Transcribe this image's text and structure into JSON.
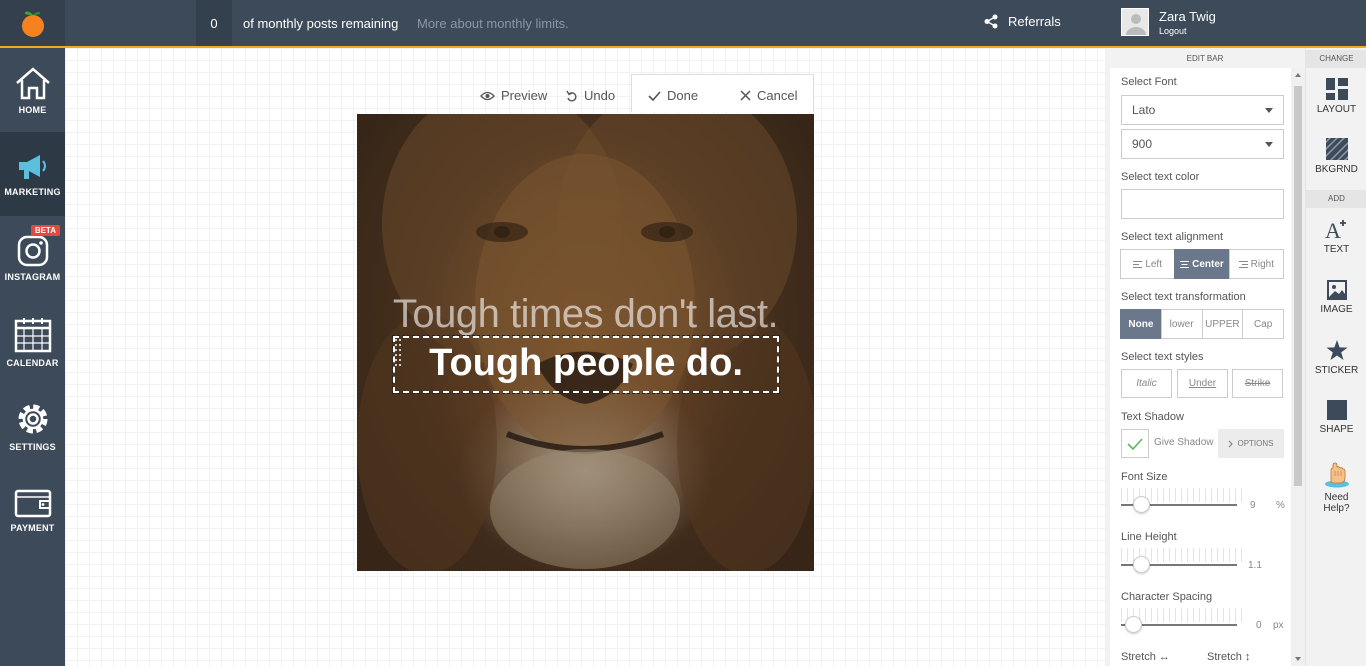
{
  "topbar": {
    "counter": "0",
    "posts_text": "of monthly posts remaining",
    "more_link": "More about monthly limits.",
    "referrals": "Referrals",
    "user_name": "Zara Twig",
    "logout": "Logout"
  },
  "leftnav": {
    "items": [
      {
        "label": "HOME",
        "icon": "home-icon"
      },
      {
        "label": "MARKETING",
        "icon": "megaphone-icon"
      },
      {
        "label": "INSTAGRAM",
        "icon": "instagram-icon",
        "badge": "BETA"
      },
      {
        "label": "CALENDAR",
        "icon": "calendar-icon"
      },
      {
        "label": "SETTINGS",
        "icon": "gear-icon"
      },
      {
        "label": "PAYMENT",
        "icon": "wallet-icon"
      }
    ]
  },
  "toolbar": {
    "preview": "Preview",
    "undo": "Undo",
    "done": "Done",
    "cancel": "Cancel"
  },
  "poster": {
    "line1": "Tough times don't last.",
    "line2": "Tough people do."
  },
  "editbar": {
    "title": "EDIT BAR",
    "select_font_label": "Select Font",
    "font_value": "Lato",
    "weight_value": "900",
    "text_color_label": "Select text color",
    "text_color_value": "",
    "alignment_label": "Select text alignment",
    "alignment": [
      "Left",
      "Center",
      "Right"
    ],
    "alignment_selected": "Center",
    "transformation_label": "Select text transformation",
    "transformation": [
      "None",
      "lower",
      "UPPER",
      "Cap"
    ],
    "transformation_selected": "None",
    "styles_label": "Select text styles",
    "styles": [
      "Italic",
      "Under",
      "Strike"
    ],
    "shadow_label": "Text Shadow",
    "give_shadow": "Give Shadow",
    "options": "OPTIONS",
    "font_size_label": "Font Size",
    "font_size_value": "9",
    "font_size_unit": "%",
    "line_height_label": "Line Height",
    "line_height_value": "1.1",
    "char_spacing_label": "Character Spacing",
    "char_spacing_value": "0",
    "char_spacing_unit": "px",
    "stretch_h": "Stretch ↔",
    "stretch_v": "Stretch ↕"
  },
  "rightbar": {
    "change_head": "CHANGE",
    "add_head": "ADD",
    "layout": "LAYOUT",
    "bkgrnd": "BKGRND",
    "text": "TEXT",
    "image": "IMAGE",
    "sticker": "STICKER",
    "shape": "SHAPE",
    "need_help": "Need Help?"
  },
  "colors": {
    "topbar": "#3d4a5a",
    "accent": "#f5a623",
    "active_segment": "#6b778a",
    "beta_badge": "#e5483f"
  }
}
